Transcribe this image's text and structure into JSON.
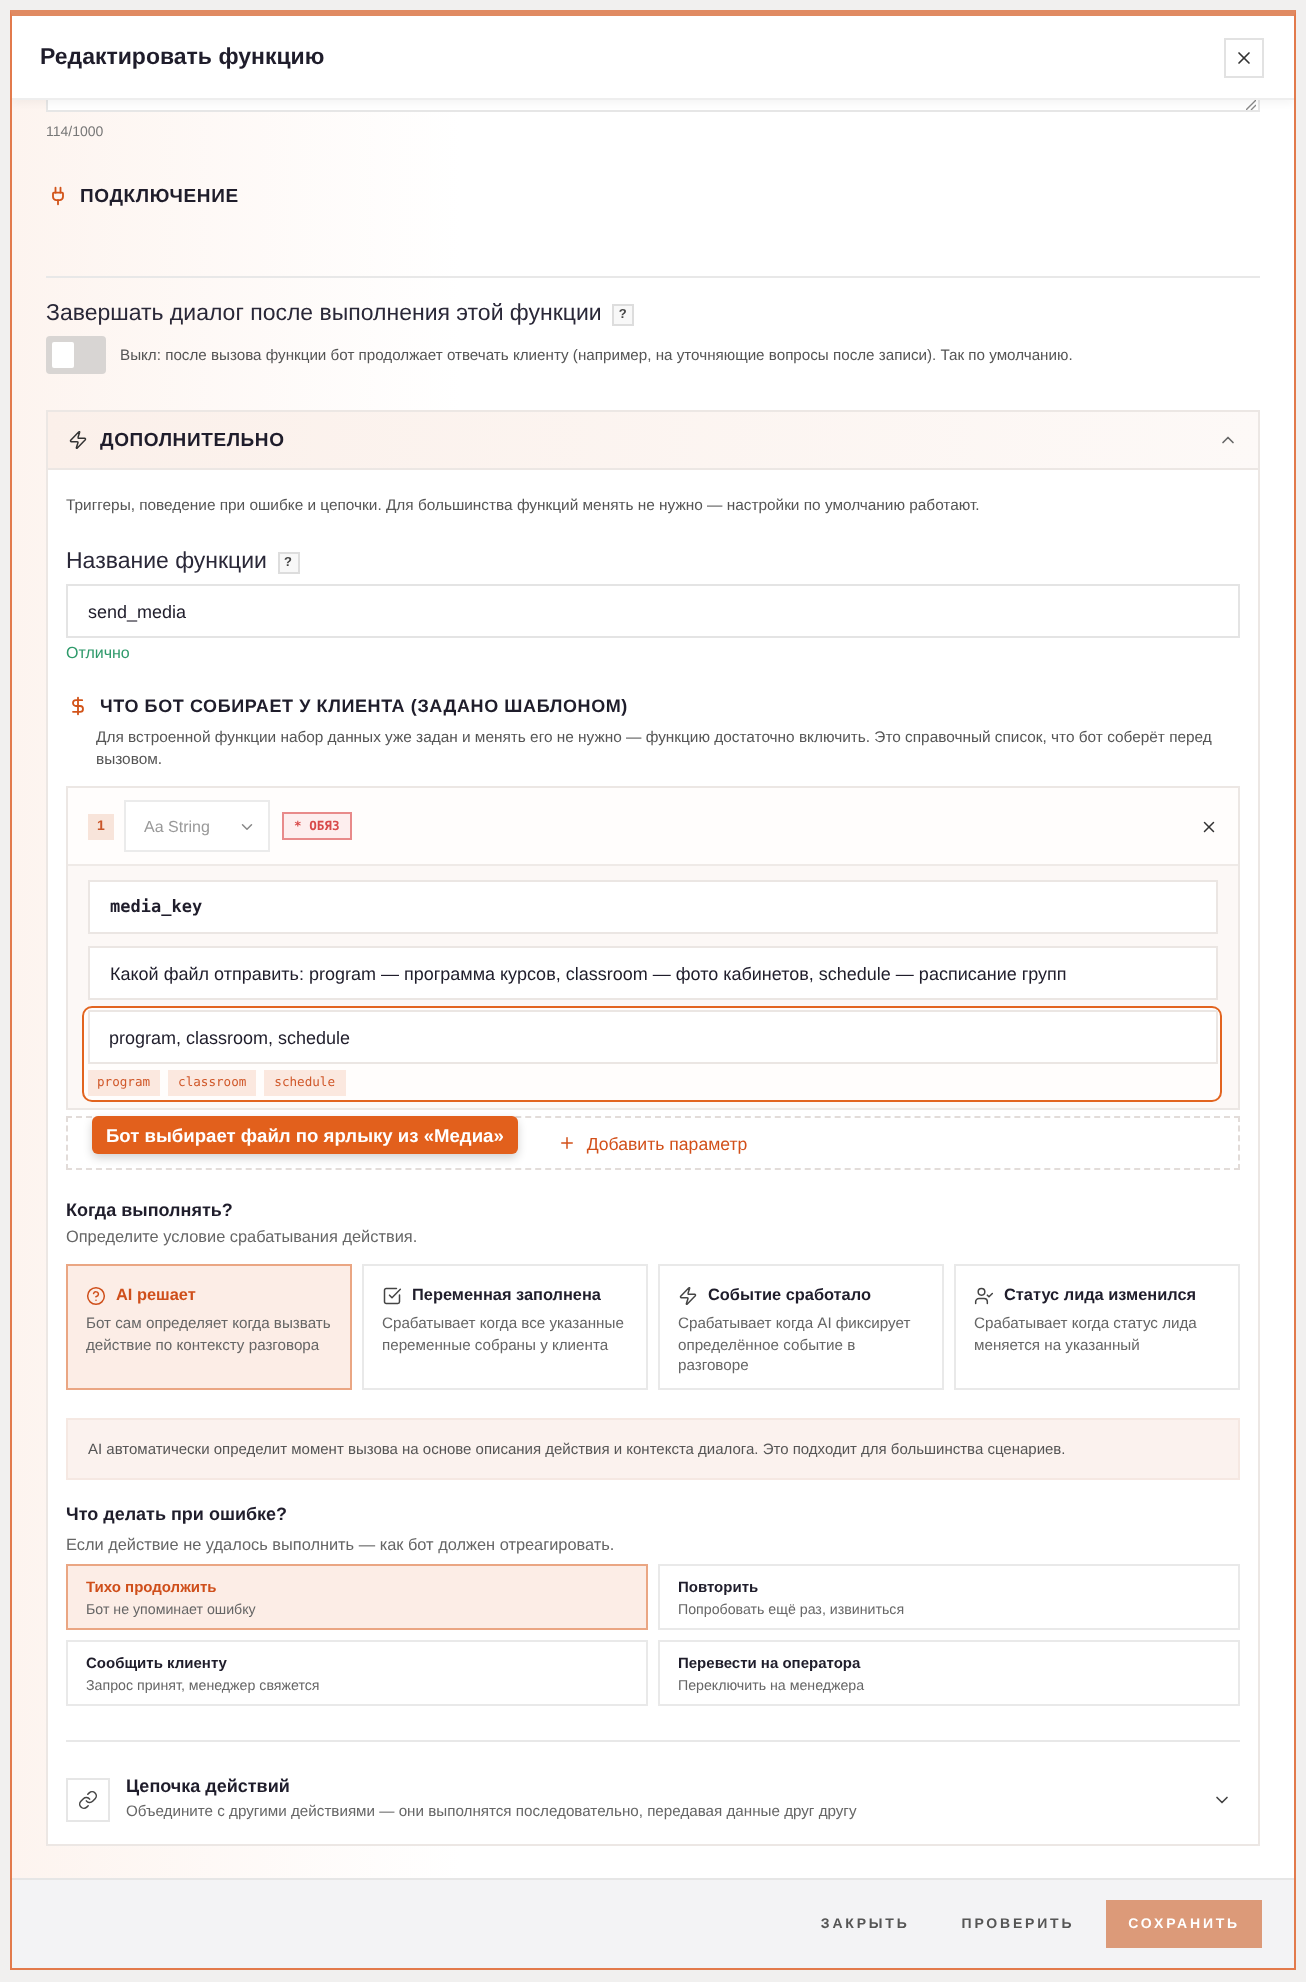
{
  "window": {
    "title": "Редактировать функцию"
  },
  "description_counter": "114/1000",
  "connection": {
    "title": "ПОДКЛЮЧЕНИЕ"
  },
  "end_dialog": {
    "label": "Завершать диалог после выполнения этой функции",
    "help": "?",
    "on": false,
    "hint": "Выкл: после вызова функции бот продолжает отвечать клиенту (например, на уточняющие вопросы после записи). Так по умолчанию."
  },
  "advanced": {
    "title": "ДОПОЛНИТЕЛЬНО",
    "expanded": true,
    "description": "Триггеры, поведение при ошибке и цепочки. Для большинства функций менять не нужно — настройки по умолчанию работают.",
    "function_name": {
      "label": "Название функции",
      "help": "?",
      "value": "send_media",
      "status": "Отлично"
    },
    "collected": {
      "title": "ЧТО БОТ СОБИРАЕТ У КЛИЕНТА (ЗАДАНО ШАБЛОНОМ)",
      "description": "Для встроенной функции набор данных уже задан и менять его не нужно — функцию достаточно включить. Это справочный список, что бот соберёт перед вызовом.",
      "parameters": [
        {
          "index": "1",
          "type": "Aa String",
          "required": true,
          "required_label": "* ОБЯЗ",
          "name": "media_key",
          "description": "Какой файл отправить: program — программа курсов, classroom — фото кабинетов, schedule — расписание групп",
          "values": "program, classroom, schedule",
          "tags": [
            "program",
            "classroom",
            "schedule"
          ]
        }
      ],
      "tooltip": "Бот выбирает файл по ярлыку из «Медиа»",
      "add_label": "Добавить параметр"
    },
    "when": {
      "title": "Когда выполнять?",
      "subtitle": "Определите условие срабатывания действия.",
      "options": [
        {
          "kind": "ai",
          "title": "AI решает",
          "description": "Бот сам определяет когда вызвать действие по контексту разговора",
          "selected": true
        },
        {
          "kind": "variable",
          "title": "Переменная заполнена",
          "description": "Срабатывает когда все указанные переменные собраны у клиента",
          "selected": false
        },
        {
          "kind": "event",
          "title": "Событие сработало",
          "description": "Срабатывает когда AI фиксирует определённое событие в разговоре",
          "selected": false
        },
        {
          "kind": "status",
          "title": "Статус лида изменился",
          "description": "Срабатывает когда статус лида меняется на указанный",
          "selected": false
        }
      ],
      "info": "AI автоматически определит момент вызова на основе описания действия и контекста диалога. Это подходит для большинства сценариев."
    },
    "on_error": {
      "title": "Что делать при ошибке?",
      "subtitle": "Если действие не удалось выполнить — как бот должен отреагировать.",
      "options": [
        {
          "title": "Тихо продолжить",
          "description": "Бот не упоминает ошибку",
          "selected": true
        },
        {
          "title": "Повторить",
          "description": "Попробовать ещё раз, извиниться",
          "selected": false
        },
        {
          "title": "Сообщить клиенту",
          "description": "Запрос принят, менеджер свяжется",
          "selected": false
        },
        {
          "title": "Перевести на оператора",
          "description": "Переключить на менеджера",
          "selected": false
        }
      ]
    },
    "chain": {
      "title": "Цепочка действий",
      "description": "Объедините с другими действиями — они выполнятся последовательно, передавая данные друг другу",
      "expanded": false
    }
  },
  "footer": {
    "buttons": [
      {
        "kind": "text",
        "label": "ЗАКРЫТЬ"
      },
      {
        "kind": "text",
        "label": "ПРОВЕРИТЬ"
      },
      {
        "kind": "primary",
        "label": "СОХРАНИТЬ"
      }
    ]
  }
}
